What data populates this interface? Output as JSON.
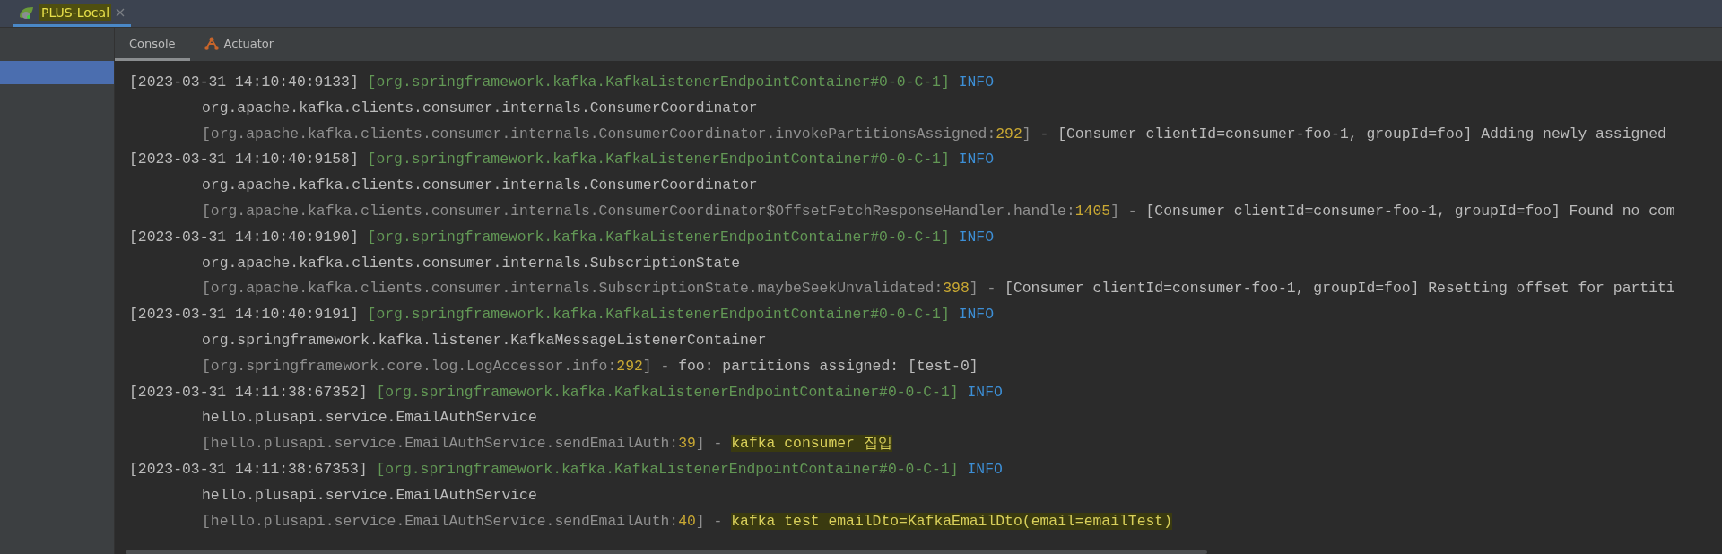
{
  "run_tab": {
    "title": "PLUS-Local",
    "selected": true,
    "highlighted": true
  },
  "console_tabs": [
    {
      "label": "Console",
      "selected": true,
      "kind": "console"
    },
    {
      "label": "Actuator",
      "selected": false,
      "kind": "actuator"
    }
  ],
  "sidebar": {
    "items": [
      {
        "selected": true
      }
    ]
  },
  "log_entries": [
    {
      "timestamp": "[2023-03-31 14:10:40:9133]",
      "thread": "[org.springframework.kafka.KafkaListenerEndpointContainer#0-0-C-1]",
      "level": "INFO",
      "logger": "org.apache.kafka.clients.consumer.internals.ConsumerCoordinator",
      "location": "[org.apache.kafka.clients.consumer.internals.ConsumerCoordinator.invokePartitionsAssigned:",
      "line": "292",
      "separator": "] - ",
      "message": "[Consumer clientId=consumer-foo-1, groupId=foo] Adding newly assigned",
      "highlighted": false
    },
    {
      "timestamp": "[2023-03-31 14:10:40:9158]",
      "thread": "[org.springframework.kafka.KafkaListenerEndpointContainer#0-0-C-1]",
      "level": "INFO",
      "logger": "org.apache.kafka.clients.consumer.internals.ConsumerCoordinator",
      "location": "[org.apache.kafka.clients.consumer.internals.ConsumerCoordinator$OffsetFetchResponseHandler.handle:",
      "line": "1405",
      "separator": "] - ",
      "message": "[Consumer clientId=consumer-foo-1, groupId=foo] Found no com",
      "highlighted": false
    },
    {
      "timestamp": "[2023-03-31 14:10:40:9190]",
      "thread": "[org.springframework.kafka.KafkaListenerEndpointContainer#0-0-C-1]",
      "level": "INFO",
      "logger": "org.apache.kafka.clients.consumer.internals.SubscriptionState",
      "location": "[org.apache.kafka.clients.consumer.internals.SubscriptionState.maybeSeekUnvalidated:",
      "line": "398",
      "separator": "] - ",
      "message": "[Consumer clientId=consumer-foo-1, groupId=foo] Resetting offset for partiti",
      "highlighted": false
    },
    {
      "timestamp": "[2023-03-31 14:10:40:9191]",
      "thread": "[org.springframework.kafka.KafkaListenerEndpointContainer#0-0-C-1]",
      "level": "INFO",
      "logger": "org.springframework.kafka.listener.KafkaMessageListenerContainer",
      "location": "[org.springframework.core.log.LogAccessor.info:",
      "line": "292",
      "separator": "] - ",
      "message": "foo: partitions assigned: [test-0]",
      "highlighted": false
    },
    {
      "timestamp": "[2023-03-31 14:11:38:67352]",
      "thread": "[org.springframework.kafka.KafkaListenerEndpointContainer#0-0-C-1]",
      "level": "INFO",
      "logger": "hello.plusapi.service.EmailAuthService",
      "location": "[hello.plusapi.service.EmailAuthService.sendEmailAuth:",
      "line": "39",
      "separator": "] - ",
      "message": "kafka consumer 집입",
      "highlighted": true
    },
    {
      "timestamp": "[2023-03-31 14:11:38:67353]",
      "thread": "[org.springframework.kafka.KafkaListenerEndpointContainer#0-0-C-1]",
      "level": "INFO",
      "logger": "hello.plusapi.service.EmailAuthService",
      "location": "[hello.plusapi.service.EmailAuthService.sendEmailAuth:",
      "line": "40",
      "separator": "] - ",
      "message": "kafka test emailDto=KafkaEmailDto(email=emailTest)",
      "highlighted": true
    }
  ]
}
